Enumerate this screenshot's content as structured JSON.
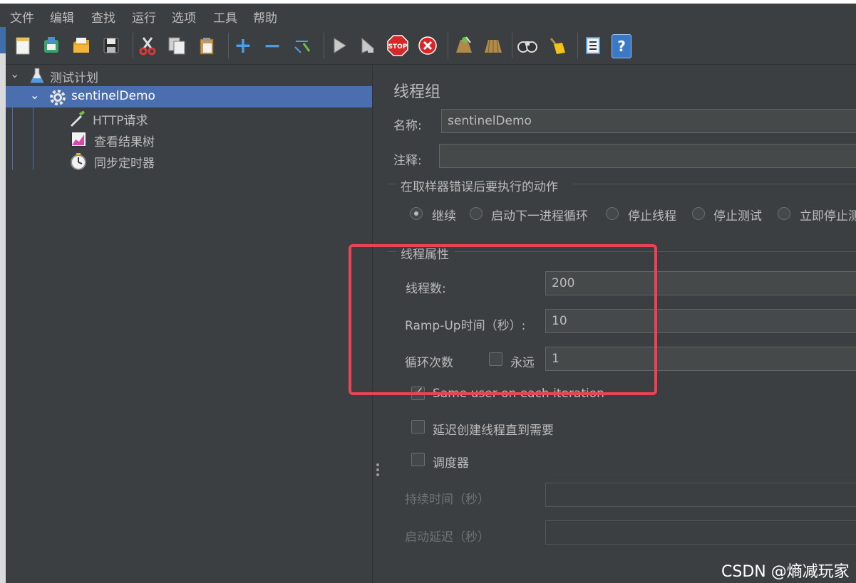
{
  "menu": [
    "文件",
    "编辑",
    "查找",
    "运行",
    "选项",
    "工具",
    "帮助"
  ],
  "toolbar": {
    "icons": [
      "new-icon",
      "templates-icon",
      "open-icon",
      "save-icon",
      "cut-icon",
      "copy-icon",
      "paste-icon",
      "expand-icon",
      "collapse-icon",
      "toggle-icon",
      "start-icon",
      "start-no-pause-icon",
      "stop-icon",
      "shutdown-icon",
      "clear-icon",
      "clear-all-icon",
      "search-icon",
      "reset-search-icon",
      "function-helper-icon",
      "help-icon"
    ],
    "add_glyph": "+",
    "remove_glyph": "−",
    "stop_text": "STOP",
    "help_glyph": "?"
  },
  "tree": {
    "root": "测试计划",
    "thread_group": "sentinelDemo",
    "children": [
      "HTTP请求",
      "查看结果树",
      "同步定时器"
    ]
  },
  "panel": {
    "title": "线程组",
    "name_label": "名称:",
    "name_value": "sentinelDemo",
    "comment_label": "注释:",
    "comment_value": "",
    "error_group_title": "在取样器错误后要执行的动作",
    "error_actions": [
      "继续",
      "启动下一进程循环",
      "停止线程",
      "停止测试",
      "立即停止测"
    ],
    "selected_error_action": "继续",
    "props_title": "线程属性",
    "threads_label": "线程数:",
    "threads_value": "200",
    "rampup_label": "Ramp-Up时间（秒）:",
    "rampup_value": "10",
    "loop_label": "循环次数",
    "forever_label": "永远",
    "forever_checked": false,
    "loop_value": "1",
    "same_user_label": "Same user on each iteration",
    "same_user_checked": true,
    "delay_label": "延迟创建线程直到需要",
    "delay_checked": false,
    "scheduler_label": "调度器",
    "scheduler_checked": false,
    "duration_label": "持续时间（秒）",
    "duration_value": "",
    "startup_delay_label": "启动延迟（秒）",
    "startup_delay_value": ""
  },
  "watermark": "CSDN @熵减玩家",
  "highlight_color": "#e84456"
}
